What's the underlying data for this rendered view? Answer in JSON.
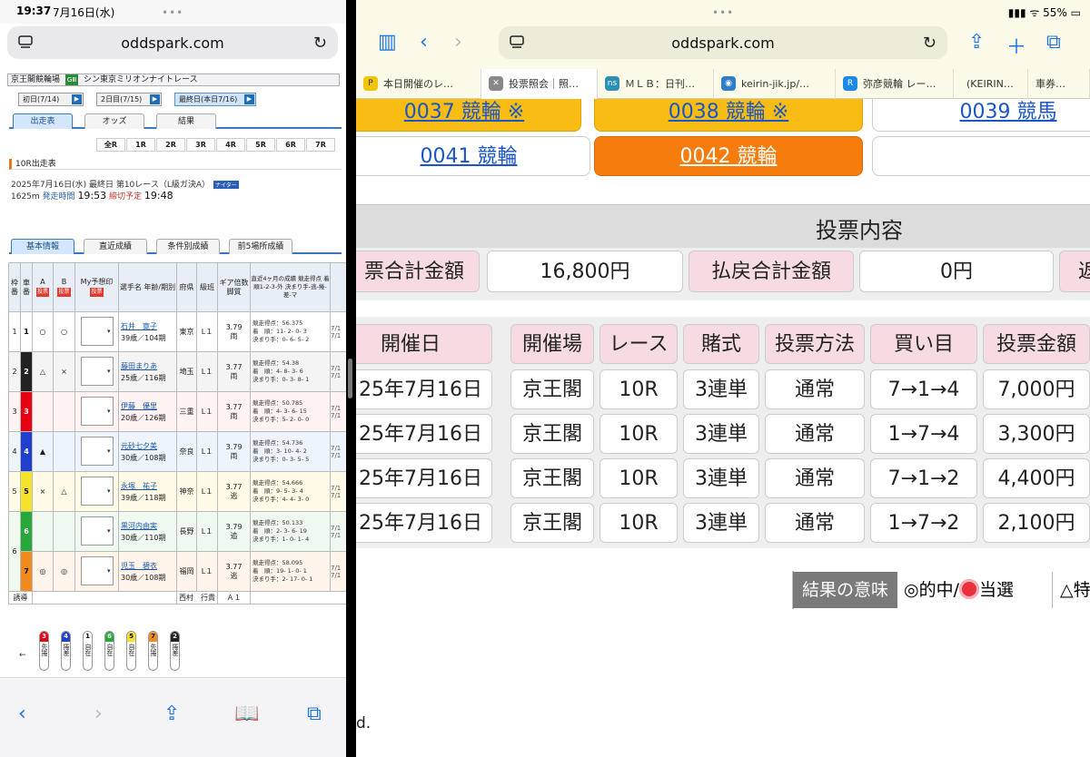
{
  "left": {
    "status": {
      "time": "19:37",
      "date": "7月16日(水)"
    },
    "url": "oddspark.com",
    "venue": {
      "name": "京王閣競輪場",
      "grade": "GⅢ",
      "race_name": "シン東京ミリオンナイトレース"
    },
    "days": [
      {
        "label": "初日(7/14)"
      },
      {
        "label": "2日目(7/15)"
      },
      {
        "label": "最終日(本日7/16)"
      }
    ],
    "tabs": [
      "出走表",
      "オッズ",
      "結果"
    ],
    "races": [
      "全R",
      "1R",
      "2R",
      "3R",
      "4R",
      "5R",
      "6R",
      "7R"
    ],
    "race_title": "10R出走表",
    "race_info1": "2025年7月16日(水) 最終日 第10レース（L級ガ決A）",
    "night_badge": "ナイター",
    "race_distance": "1625m",
    "start_label": "発走時間",
    "start_time": "19:53",
    "close_label": "締切予定",
    "close_time": "19:48",
    "info_tabs": [
      "基本情報",
      "直近成績",
      "条件別成績",
      "前5場所成績"
    ],
    "headers": {
      "waku": "枠番",
      "sha": "車番",
      "yoso": "予想印",
      "a": "A",
      "b": "B",
      "my": "My予想印",
      "vote": "投票",
      "name": "選手名 年齢/期別",
      "pref": "府県",
      "class": "級班",
      "gear": "ギア倍数 脚質",
      "recent": "直近4ヶ月の成績 競走得点 着順1-2-3-外 決まり手-逃-捲-差-マ"
    },
    "riders": [
      {
        "waku": "1",
        "sha": "1",
        "a": "○",
        "b": "○",
        "name": "石井　寛子",
        "age": "39歳／104期",
        "pref": "東京",
        "cls": "L１",
        "gear": "3.79",
        "style": "両",
        "pts": "競走得点：56.375",
        "rank": "着　順：11- 2- 0- 3",
        "kimari": "決まり手：0- 6- 5- 2"
      },
      {
        "waku": "2",
        "sha": "2",
        "a": "△",
        "b": "×",
        "name": "藤田まりあ",
        "age": "25歳／116期",
        "pref": "埼玉",
        "cls": "L１",
        "gear": "3.77",
        "style": "両",
        "pts": "競走得点：54.38",
        "rank": "着　順：4- 8- 3- 6",
        "kimari": "決まり手：0- 3- 8- 1"
      },
      {
        "waku": "3",
        "sha": "3",
        "a": "",
        "b": "",
        "name": "伊藤　優里",
        "age": "20歳／126期",
        "pref": "三重",
        "cls": "L１",
        "gear": "3.77",
        "style": "両",
        "pts": "競走得点：50.785",
        "rank": "着　順：4- 3- 6- 15",
        "kimari": "決まり手：5- 2- 0- 0"
      },
      {
        "waku": "4",
        "sha": "4",
        "a": "▲",
        "b": "",
        "name": "元砂七夕美",
        "age": "30歳／108期",
        "pref": "奈良",
        "cls": "L１",
        "gear": "3.79",
        "style": "両",
        "pts": "競走得点：54.736",
        "rank": "着　順：3- 10- 4- 2",
        "kimari": "決まり手：0- 3- 5- 5"
      },
      {
        "waku": "5",
        "sha": "5",
        "a": "×",
        "b": "△",
        "name": "永塚　祐子",
        "age": "39歳／118期",
        "pref": "神奈",
        "cls": "L１",
        "gear": "3.77",
        "style": "逃",
        "pts": "競走得点：54.666",
        "rank": "着　順：9- 5- 3- 4",
        "kimari": "決まり手：4- 4- 3- 0"
      },
      {
        "waku": "6",
        "sha": "6",
        "a": "",
        "b": "",
        "name": "黒河内由実",
        "age": "30歳／110期",
        "pref": "長野",
        "cls": "L１",
        "gear": "3.79",
        "style": "追",
        "pts": "競走得点：50.133",
        "rank": "着　順：2- 3- 6- 19",
        "kimari": "決まり手：1- 0- 1- 4"
      },
      {
        "waku": "",
        "sha": "7",
        "a": "◎",
        "b": "◎",
        "name": "児玉　碧衣",
        "age": "30歳／108期",
        "pref": "福岡",
        "cls": "L１",
        "gear": "3.77",
        "style": "逃",
        "pts": "競走得点：58.095",
        "rank": "着　順：19- 1- 0- 1",
        "kimari": "決まり手：2- 17- 0- 1"
      }
    ],
    "guide_label": "誘導",
    "guide_name": "西村　行貴",
    "guide_class": "Ａ１",
    "lineup": [
      {
        "n": "3",
        "t": "先捲"
      },
      {
        "n": "4",
        "t": "捲差"
      },
      {
        "n": "1",
        "t": "自在"
      },
      {
        "n": "6",
        "t": "自在"
      },
      {
        "n": "5",
        "t": "自在"
      },
      {
        "n": "7",
        "t": "先捲"
      },
      {
        "n": "2",
        "t": "捲差"
      }
    ],
    "lineup_arrow": "←"
  },
  "right": {
    "status": {
      "battery": "55%"
    },
    "url": "oddspark.com",
    "tabs": [
      {
        "label": "本日開催のレ…"
      },
      {
        "label": "投票照会｜照…"
      },
      {
        "label": "ＭＬＢ：日刊…"
      },
      {
        "label": "keirin-jik.jp/…"
      },
      {
        "label": "弥彦競輪 レー…"
      },
      {
        "label": "(KEIRIN…"
      },
      {
        "label": "車券…"
      }
    ],
    "tickets": [
      {
        "label": "0037 競輪 ※"
      },
      {
        "label": "0038 競輪 ※"
      },
      {
        "label": "0039 競馬"
      },
      {
        "label": "0041 競輪"
      },
      {
        "label": "0042 競輪"
      }
    ],
    "section_title": "投票内容",
    "summary": {
      "total_label": "票合計金額",
      "total_value": "16,800円",
      "refund_label": "払戻合計金額",
      "refund_value": "0円",
      "extra_label": "返"
    },
    "columns": [
      "開催日",
      "開催場",
      "レース",
      "賭式",
      "投票方法",
      "買い目",
      "投票金額"
    ],
    "rows": [
      {
        "date": "25年7月16日",
        "venue": "京王閣",
        "race": "10R",
        "bet": "3連単",
        "method": "通常",
        "combo": "7→1→4",
        "amount": "7,000円"
      },
      {
        "date": "25年7月16日",
        "venue": "京王閣",
        "race": "10R",
        "bet": "3連単",
        "method": "通常",
        "combo": "1→7→4",
        "amount": "3,300円"
      },
      {
        "date": "25年7月16日",
        "venue": "京王閣",
        "race": "10R",
        "bet": "3連単",
        "method": "通常",
        "combo": "7→1→2",
        "amount": "4,400円"
      },
      {
        "date": "25年7月16日",
        "venue": "京王閣",
        "race": "10R",
        "bet": "3連単",
        "method": "通常",
        "combo": "1→7→2",
        "amount": "2,100円"
      }
    ],
    "legend": {
      "title": "結果の意味",
      "hit": "◎的中/",
      "win": "当選",
      "other": "△特"
    },
    "footnote": "d."
  }
}
